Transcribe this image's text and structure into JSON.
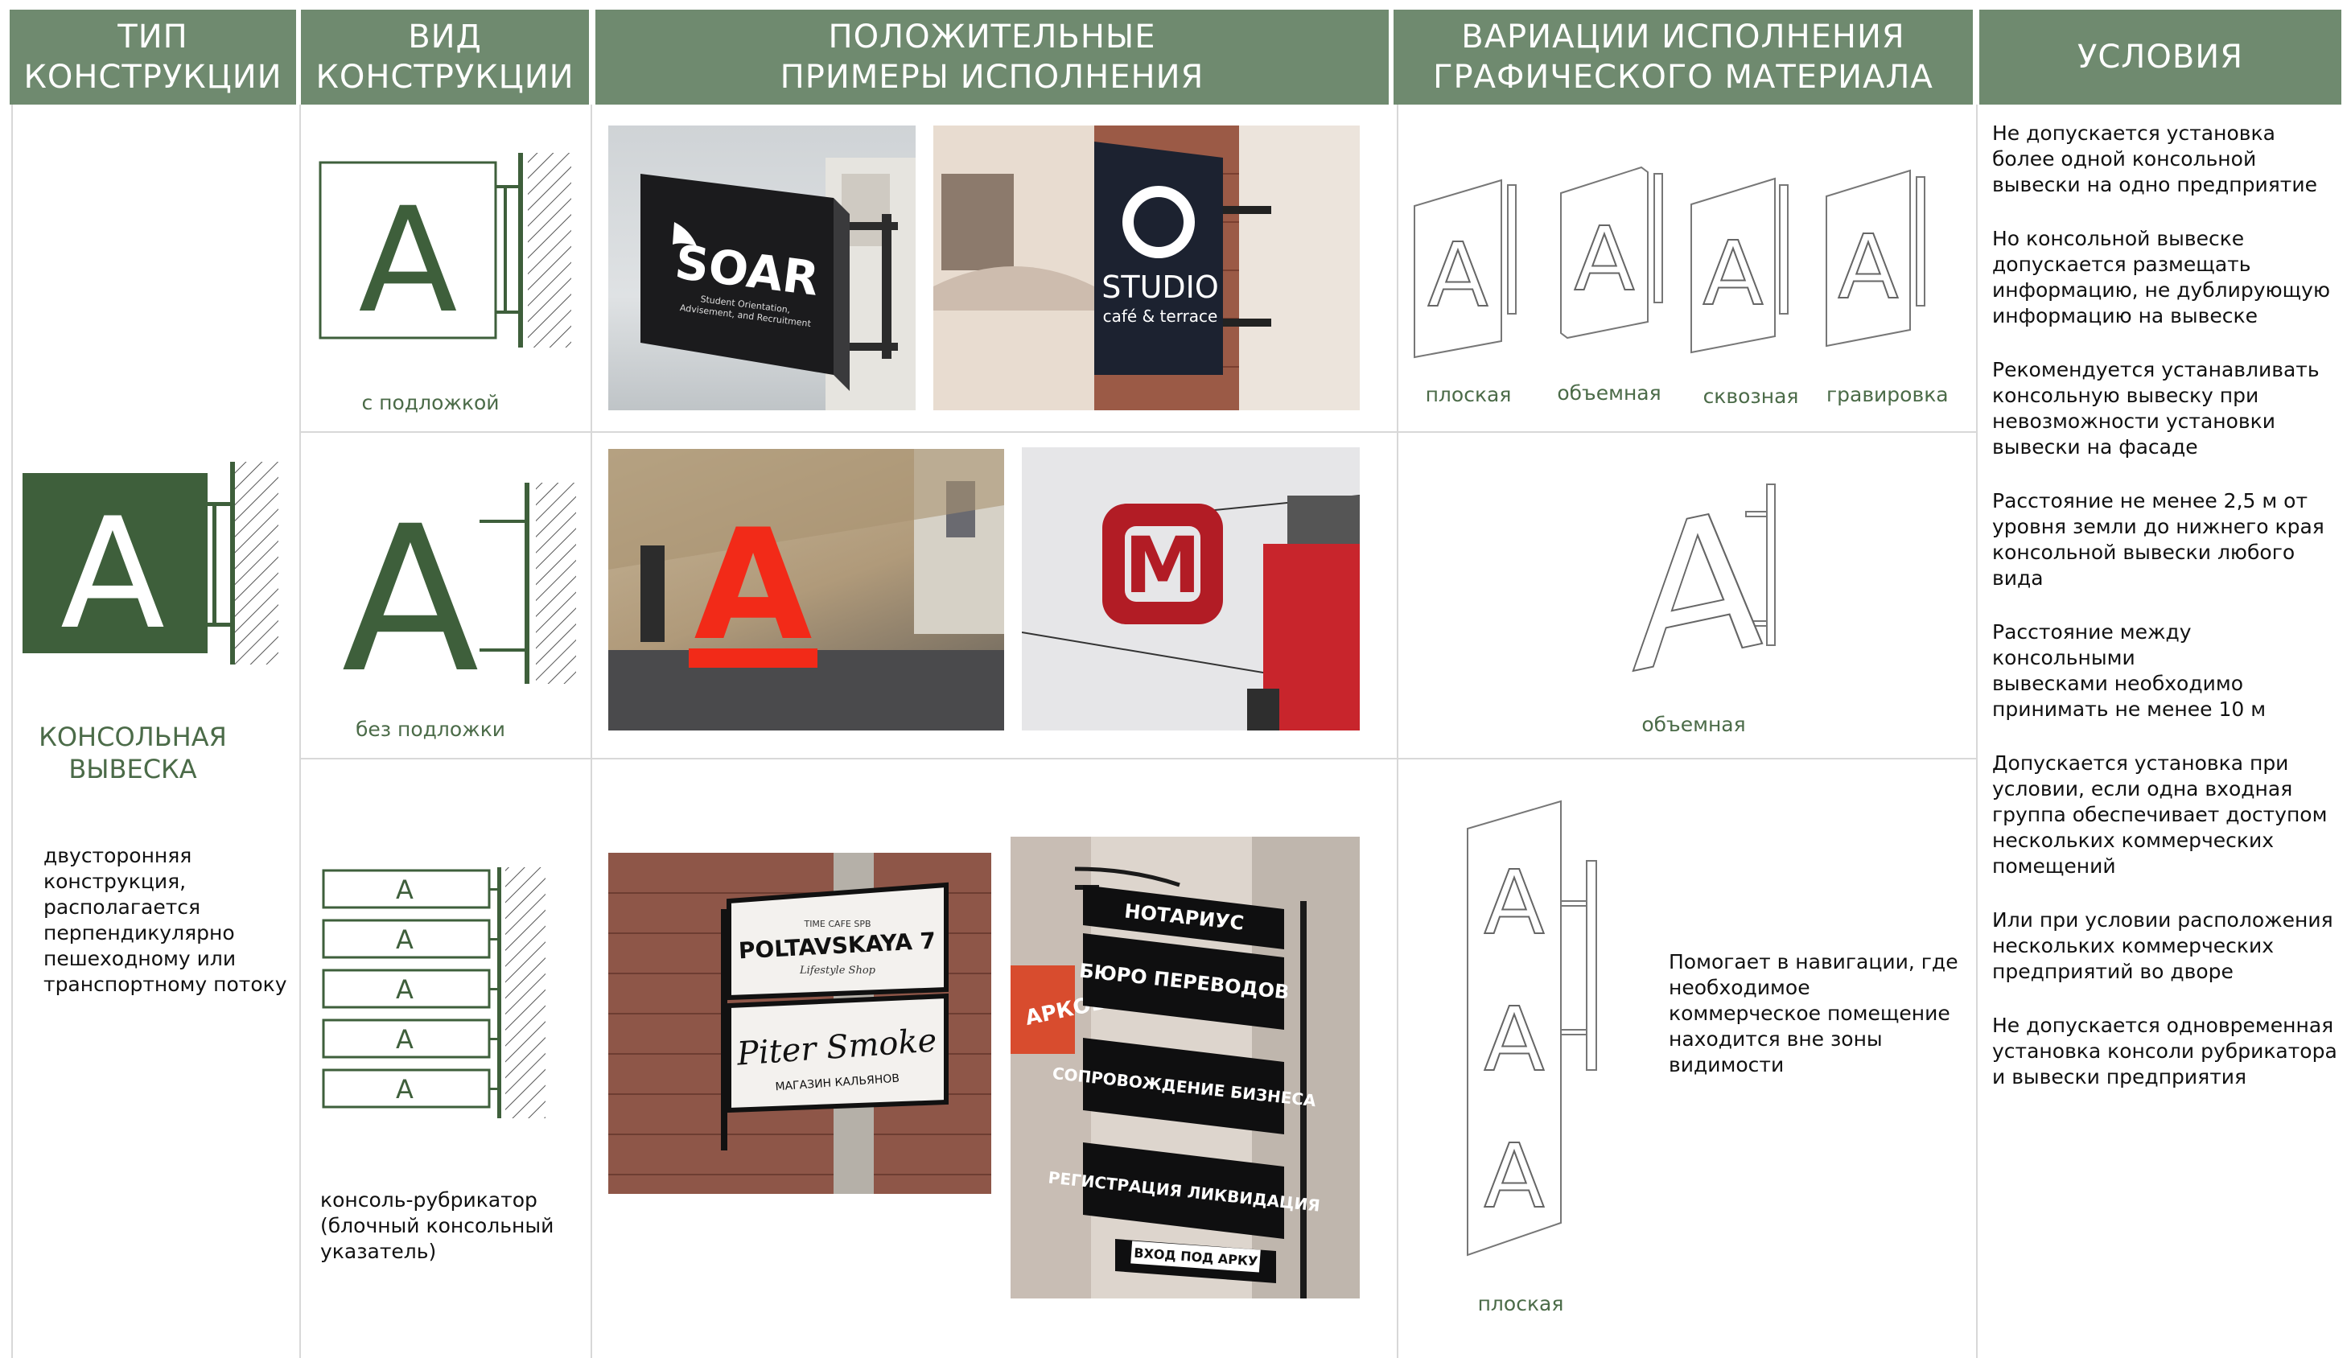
{
  "colors": {
    "header_bg": "#6f8a6f",
    "accent_green": "#3e5f3b",
    "caption_green": "#4b6b48"
  },
  "headers": {
    "type_line1": "ТИП",
    "type_line2": "КОНСТРУКЦИИ",
    "kind_line1": "ВИД",
    "kind_line2": "КОНСТРУКЦИИ",
    "examples_line1": "ПОЛОЖИТЕЛЬНЫЕ",
    "examples_line2": "ПРИМЕРЫ ИСПОЛНЕНИЯ",
    "variations_line1": "ВАРИАЦИИ ИСПОЛНЕНИЯ",
    "variations_line2": "ГРАФИЧЕСКОГО МАТЕРИАЛА",
    "conditions": "УСЛОВИЯ"
  },
  "type": {
    "icon_letter": "A",
    "title_line1": "КОНСОЛЬНАЯ",
    "title_line2": "ВЫВЕСКА",
    "desc": [
      "двусторонняя",
      "конструкция,",
      "располагается",
      "перпендикулярно",
      "пешеходному или",
      "транспортному потоку"
    ]
  },
  "kinds": {
    "row1": {
      "letter": "A",
      "caption": "с подложкой"
    },
    "row2": {
      "letter": "A",
      "caption": "без подложки"
    },
    "row3": {
      "letters": [
        "A",
        "A",
        "A",
        "A",
        "A"
      ],
      "caption": [
        "консоль-рубрикатор",
        "(блочный консольный",
        "указатель)"
      ]
    }
  },
  "examples": {
    "soar": {
      "brand": "SOAR",
      "sub1": "Student Orientation,",
      "sub2": "Advisement, and Recruitment"
    },
    "studio": {
      "brand": "STUDIO",
      "sub": "café & terrace"
    },
    "alfa": {
      "letter": "А"
    },
    "magnit": {
      "letter": "M"
    },
    "poltavskaya": {
      "top": "TIME CAFE SPB",
      "name": "POLTAVSKAYA 7",
      "sub": "Lifestyle Shop"
    },
    "piter": {
      "name": "Piter Smoke",
      "sub": "МАГАЗИН КАЛЬЯНОВ"
    },
    "notary": {
      "items": [
        "НОТАРИУС",
        "БЮРО ПЕРЕВОДОВ",
        "СОПРОВОЖДЕНИЕ БИЗНЕСА",
        "РЕГИСТРАЦИЯ ЛИКВИДАЦИЯ",
        "ВХОД ПОД АРКУ"
      ],
      "side": "АРКОВ"
    }
  },
  "variations": {
    "row1": [
      "плоская",
      "объемная",
      "сквозная",
      "гравировка"
    ],
    "row2": "объемная",
    "row3": {
      "caption": "плоская",
      "note": [
        "Помогает в навигации, где",
        "необходимое",
        "коммерческое помещение",
        "находится вне зоны",
        "видимости"
      ]
    }
  },
  "conditions": [
    [
      "Не допускается установка",
      "более одной консольной",
      "вывески на одно предприятие"
    ],
    [
      "Но консольной вывеске",
      "допускается размещать",
      "информацию, не дублирующую",
      "информацию на вывеске"
    ],
    [
      "Рекомендуется устанавливать",
      "консольную вывеску при",
      "невозможности установки",
      "вывески на фасаде"
    ],
    [
      "Расстояние не менее 2,5 м от",
      "уровня земли до нижнего края",
      "консольной вывески любого",
      "вида"
    ],
    [
      "Расстояние между консольными",
      "вывесками необходимо",
      "принимать не менее 10 м"
    ],
    [
      "Допускается установка при",
      "условии, если одна входная",
      "группа обеспечивает доступом",
      "нескольких коммерческих",
      "помещений"
    ],
    [
      "Или при условии расположения",
      "нескольких коммерческих",
      "предприятий во дворе"
    ],
    [
      "Не допускается одновременная",
      "установка консоли рубрикатора",
      "и вывески предприятия"
    ]
  ]
}
